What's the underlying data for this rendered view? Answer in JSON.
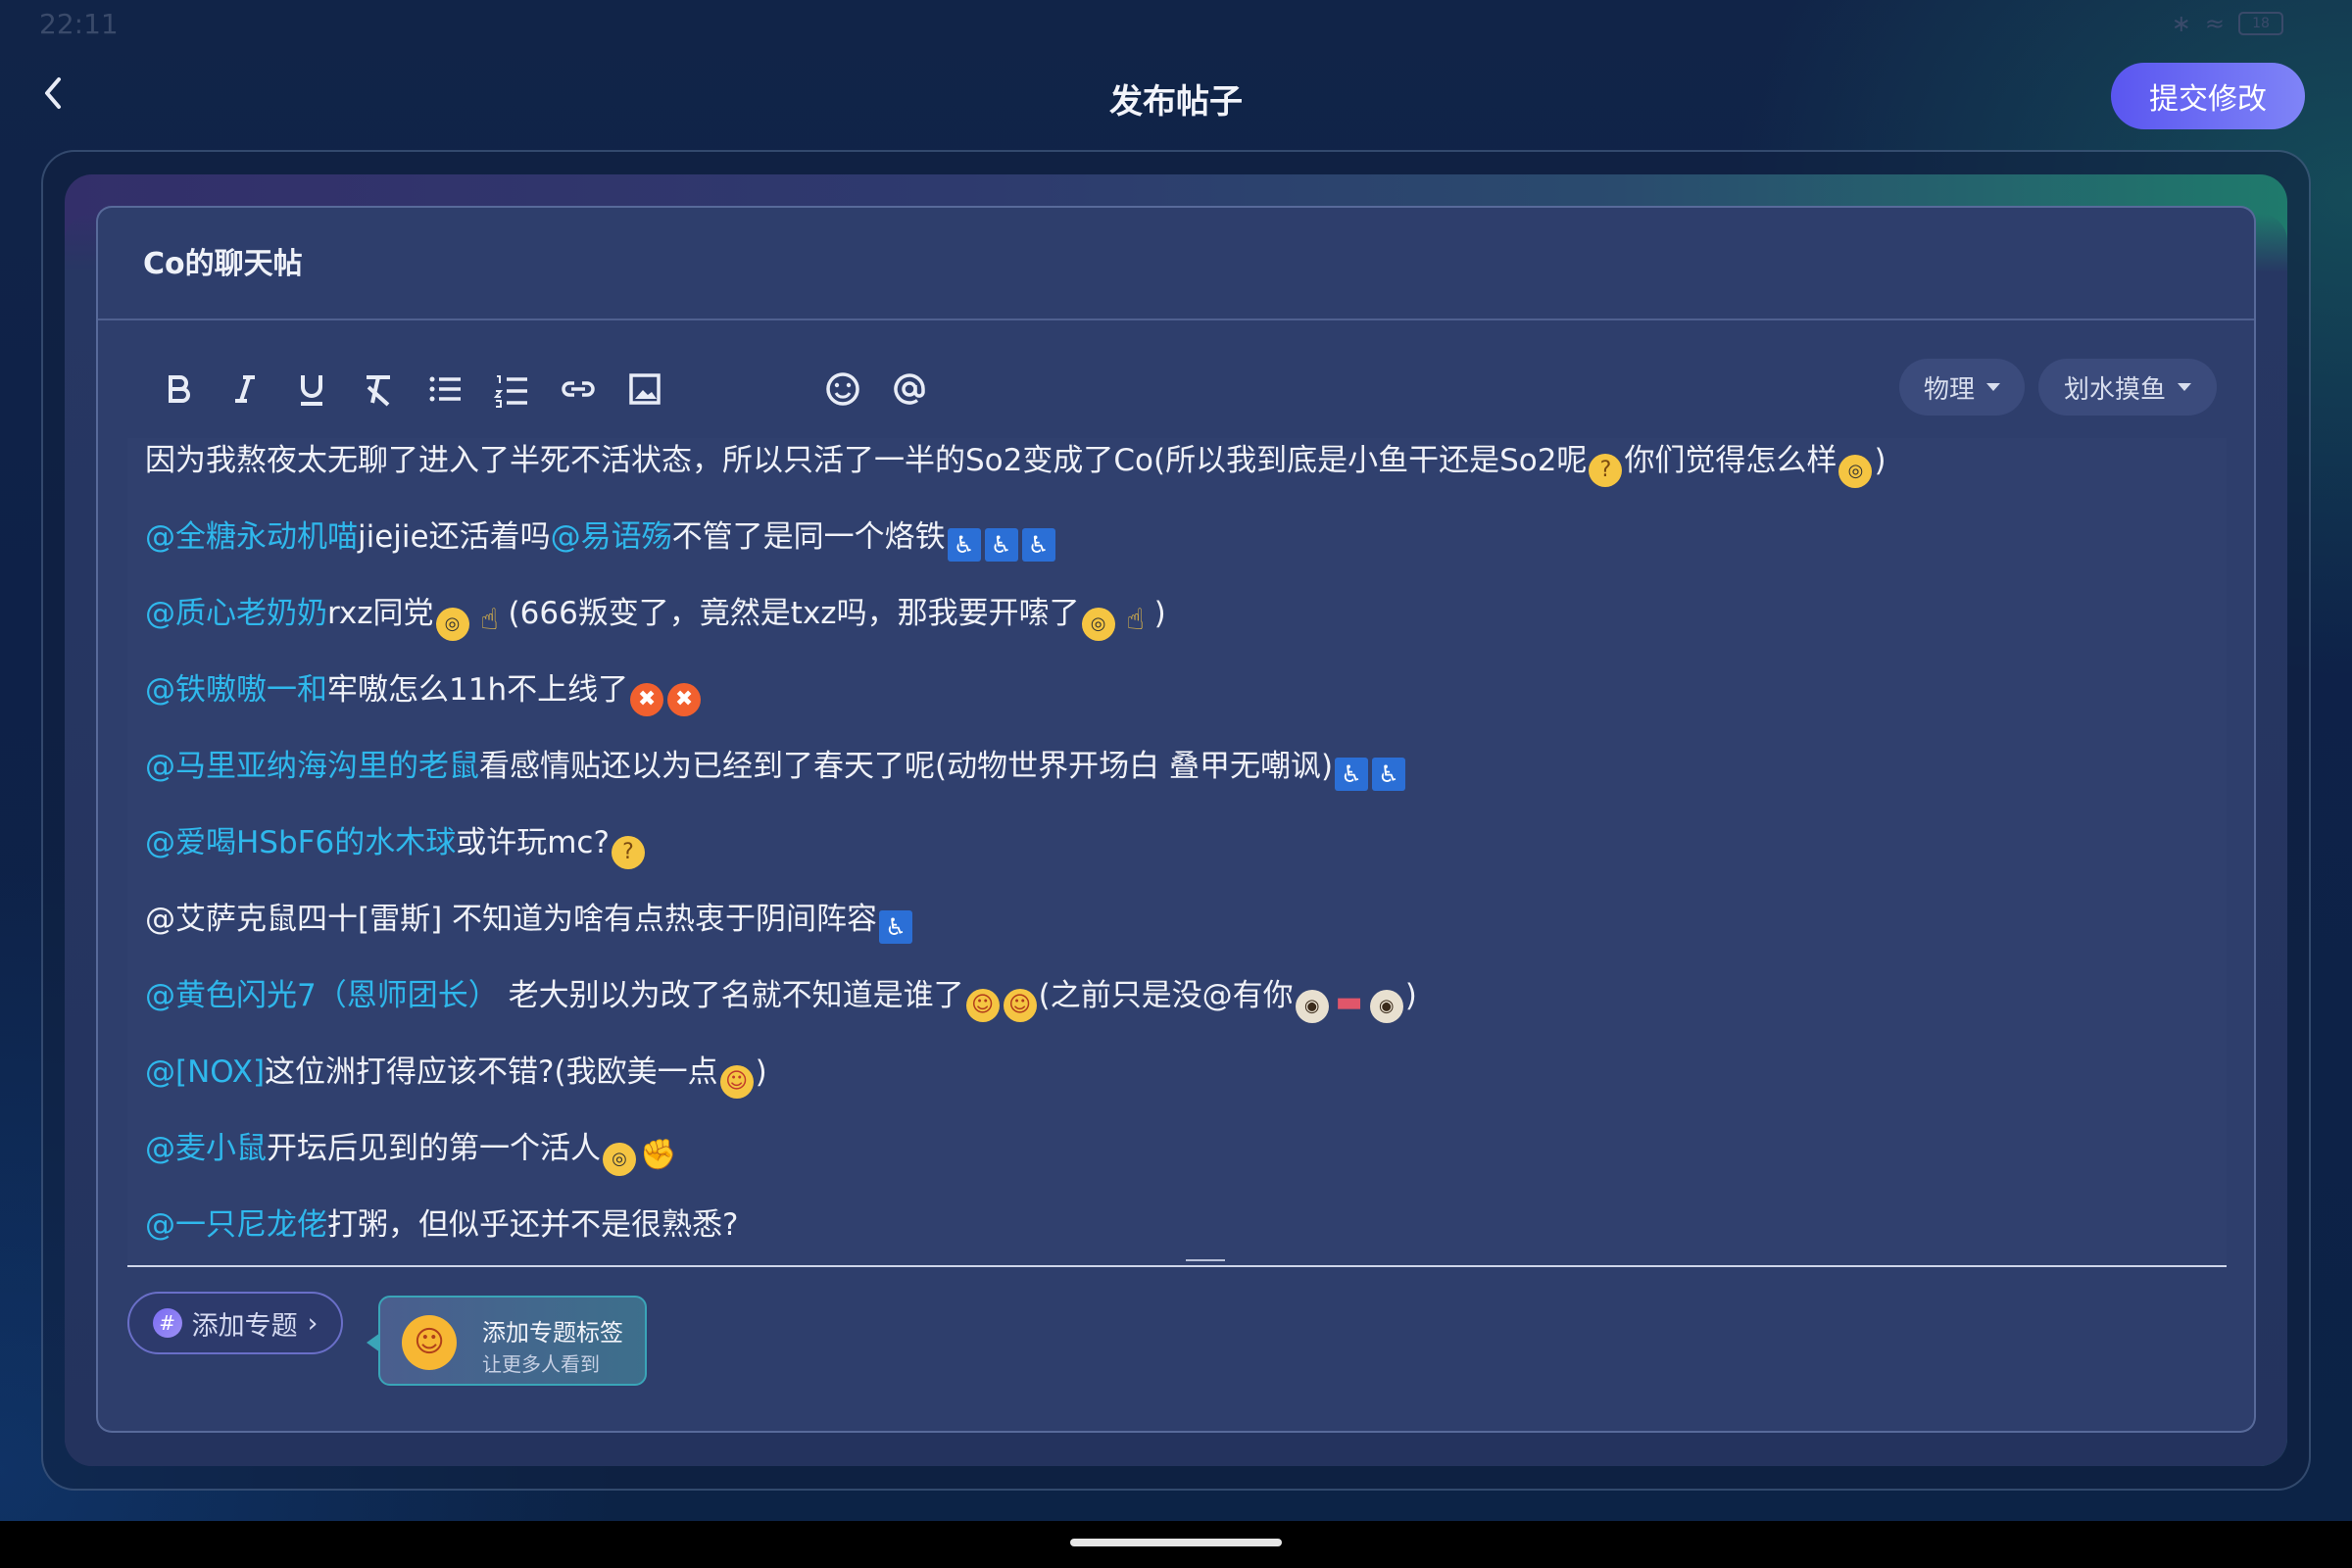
{
  "status_bar": {
    "time": "22:11",
    "battery": "18"
  },
  "header": {
    "title": "发布帖子",
    "submit_label": "提交修改"
  },
  "editor": {
    "post_title": "Co的聊天帖",
    "toolbar": [
      "bold",
      "italic",
      "underline",
      "clear-format",
      "bullet-list",
      "numbered-list",
      "link",
      "image",
      "emoji",
      "mention"
    ],
    "category_chip": "物理",
    "subcategory_chip": "划水摸鱼",
    "lines": [
      {
        "parts": [
          {
            "t": "text",
            "v": "因为我熬夜太无聊了进入了半死不活状态，所以只活了一半的So2变成了Co(所以我到底是小鱼干还是So2呢"
          },
          {
            "t": "emoji",
            "v": "thinking"
          },
          {
            "t": "text",
            "v": "你们觉得怎么样"
          },
          {
            "t": "emoji",
            "v": "nerd"
          },
          {
            "t": "text",
            "v": ")"
          }
        ]
      },
      {
        "parts": [
          {
            "t": "mention",
            "v": "@全糖永动机喵"
          },
          {
            "t": "text",
            "v": "jiejie还活着吗"
          },
          {
            "t": "mention",
            "v": "@易语殇"
          },
          {
            "t": "text",
            "v": "不管了是同一个烙铁"
          },
          {
            "t": "emoji",
            "v": "wheelchair"
          },
          {
            "t": "emoji",
            "v": "wheelchair"
          },
          {
            "t": "emoji",
            "v": "wheelchair"
          }
        ]
      },
      {
        "parts": [
          {
            "t": "mention",
            "v": "@质心老奶奶"
          },
          {
            "t": "text",
            "v": "rxz同党"
          },
          {
            "t": "emoji",
            "v": "nerd"
          },
          {
            "t": "emoji",
            "v": "point-up"
          },
          {
            "t": "text",
            "v": "(666叛变了，竟然是txz吗，那我要开嗦了"
          },
          {
            "t": "emoji",
            "v": "nerd"
          },
          {
            "t": "emoji",
            "v": "point-up"
          },
          {
            "t": "text",
            "v": ")"
          }
        ]
      },
      {
        "parts": [
          {
            "t": "mention",
            "v": "@铁嗷嗷一和"
          },
          {
            "t": "text",
            "v": "牢嗷怎么11h不上线了"
          },
          {
            "t": "emoji",
            "v": "angry"
          },
          {
            "t": "emoji",
            "v": "angry"
          }
        ]
      },
      {
        "parts": [
          {
            "t": "mention",
            "v": "@马里亚纳海沟里的老鼠"
          },
          {
            "t": "text",
            "v": "看感情贴还以为已经到了春天了呢(动物世界开场白 叠甲无嘲讽)"
          },
          {
            "t": "emoji",
            "v": "wheelchair"
          },
          {
            "t": "emoji",
            "v": "wheelchair"
          }
        ]
      },
      {
        "parts": [
          {
            "t": "mention",
            "v": "@爱喝HSbF6的水木球"
          },
          {
            "t": "text",
            "v": "或许玩mc?"
          },
          {
            "t": "emoji",
            "v": "thinking"
          }
        ]
      },
      {
        "parts": [
          {
            "t": "text",
            "v": "@艾萨克鼠四十[雷斯]  不知道为啥有点热衷于阴间阵容"
          },
          {
            "t": "emoji",
            "v": "wheelchair"
          }
        ]
      },
      {
        "parts": [
          {
            "t": "mention",
            "v": "@黄色闪光7（恩师团长）"
          },
          {
            "t": "text",
            "v": "   老大别以为改了名就不知道是谁了"
          },
          {
            "t": "emoji",
            "v": "hug"
          },
          {
            "t": "emoji",
            "v": "hug"
          },
          {
            "t": "text",
            "v": "(之前只是没@有你"
          },
          {
            "t": "emoji",
            "v": "eye"
          },
          {
            "t": "emoji",
            "v": "mouth"
          },
          {
            "t": "emoji",
            "v": "eye"
          },
          {
            "t": "text",
            "v": ")"
          }
        ]
      },
      {
        "parts": [
          {
            "t": "mention",
            "v": "@[NOX]"
          },
          {
            "t": "text",
            "v": "这位洲打得应该不错?(我欧美一点"
          },
          {
            "t": "emoji",
            "v": "yum"
          },
          {
            "t": "text",
            "v": ")"
          }
        ]
      },
      {
        "parts": [
          {
            "t": "mention",
            "v": "@麦小鼠"
          },
          {
            "t": "text",
            "v": "开坛后见到的第一个活人"
          },
          {
            "t": "emoji",
            "v": "nerd"
          },
          {
            "t": "emoji",
            "v": "fist"
          }
        ]
      },
      {
        "parts": [
          {
            "t": "mention",
            "v": "@一只尼龙佬"
          },
          {
            "t": "text",
            "v": "打粥，但似乎还并不是很熟悉?"
          }
        ]
      }
    ]
  },
  "footer": {
    "add_topic_label": "添加专题",
    "tip_title": "添加专题标签",
    "tip_subtitle": "让更多人看到"
  },
  "colors": {
    "accent": "#6a63f2",
    "mention": "#2fb8ec"
  }
}
